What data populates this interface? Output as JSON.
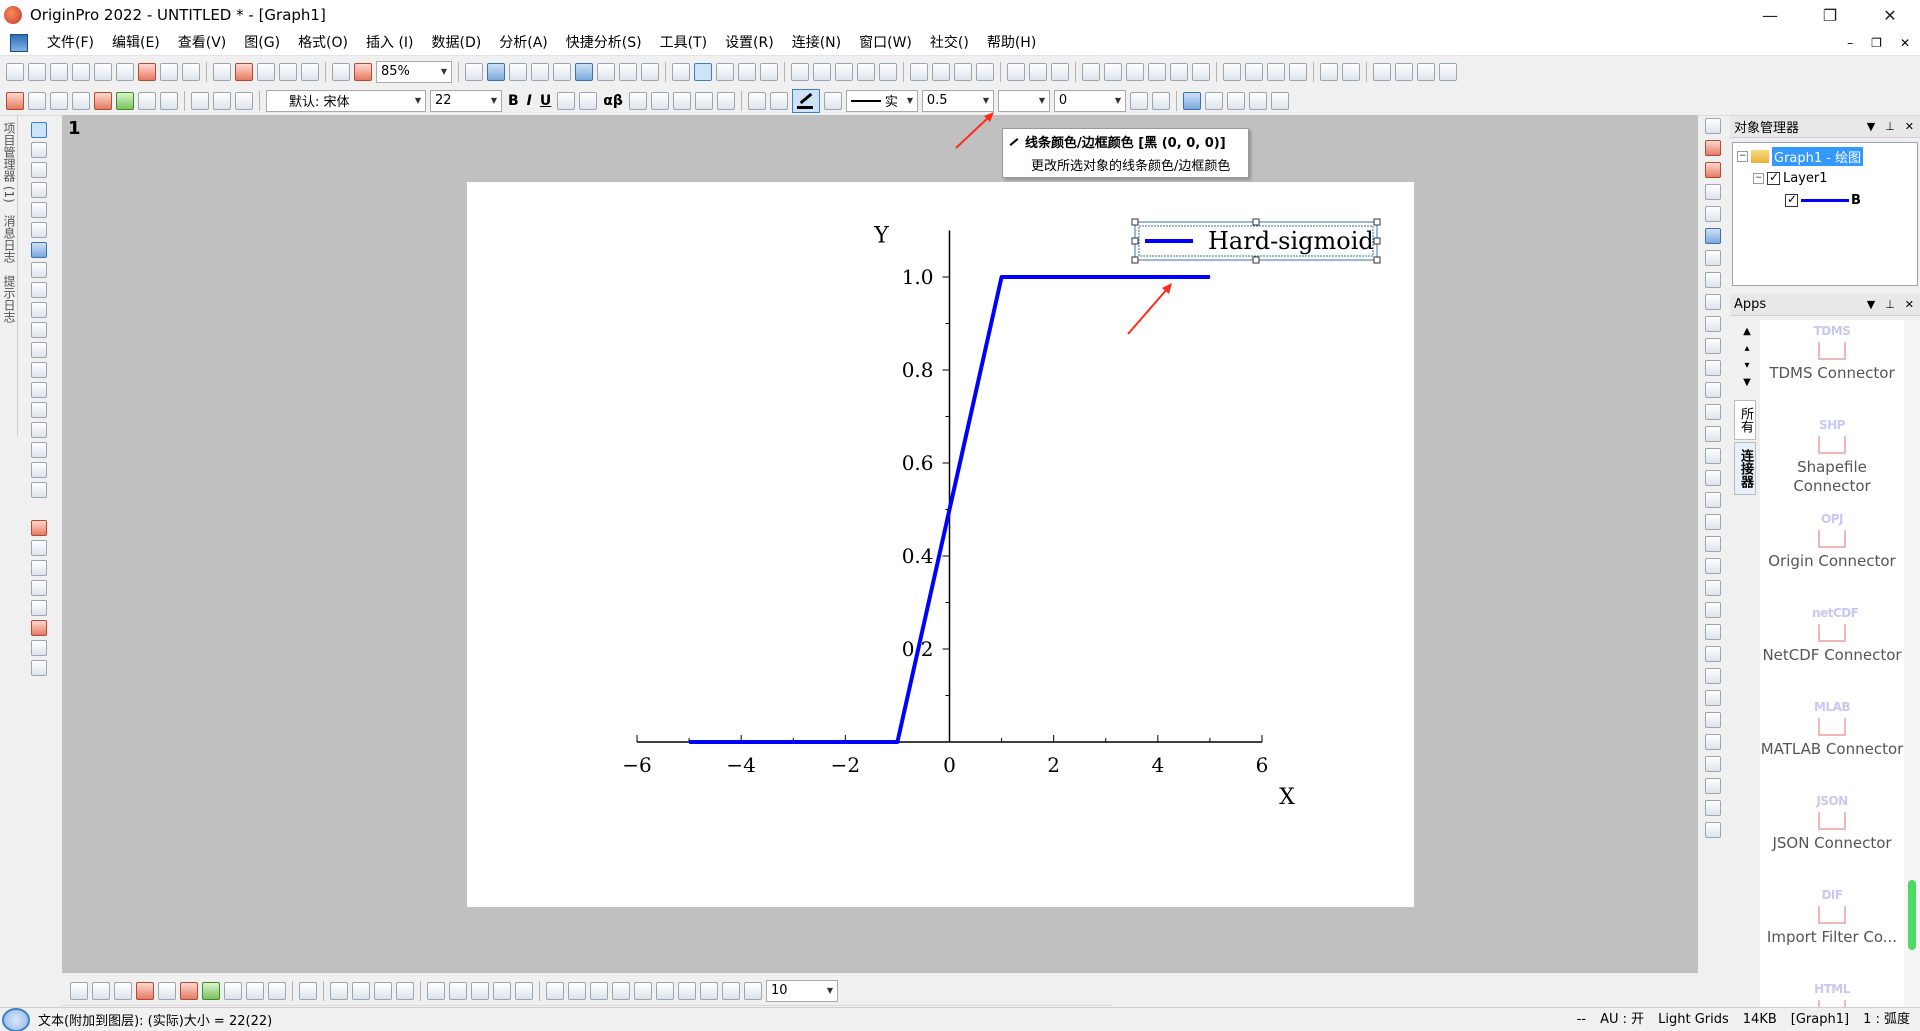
{
  "window": {
    "title": "OriginPro 2022 - UNTITLED * - [Graph1]",
    "controls": [
      "—",
      "❐",
      "✕"
    ],
    "mdi_controls": [
      "–",
      "❐",
      "✕"
    ]
  },
  "menu": [
    "文件(F)",
    "编辑(E)",
    "查看(V)",
    "图(G)",
    "格式(O)",
    "插入 (I)",
    "数据(D)",
    "分析(A)",
    "快捷分析(S)",
    "工具(T)",
    "设置(R)",
    "连接(N)",
    "窗口(W)",
    "社交()",
    "帮助(H)"
  ],
  "toolbar1": {
    "zoom_value": "85%"
  },
  "toolbar2": {
    "font_name": "默认: 宋体",
    "font_size": "22",
    "bold": "B",
    "italic": "I",
    "underline": "U",
    "greek": "αβ",
    "line_style": "实",
    "line_width": "0.5",
    "offset": "0"
  },
  "left_dock_tabs": [
    "项目管理器 (1)",
    "消息日志",
    "提示日志"
  ],
  "workspace": {
    "page_label": "1"
  },
  "tooltip": {
    "title": "线条颜色/边框颜色 [黑 (0, 0, 0)]",
    "description": "更改所选对象的线条颜色/边框颜色"
  },
  "chart_data": {
    "type": "line",
    "title": "",
    "xlabel": "X",
    "ylabel": "Y",
    "xlim": [
      -6,
      6
    ],
    "ylim": [
      0,
      1.1
    ],
    "x_ticks": [
      -6,
      -4,
      -2,
      0,
      2,
      4,
      6
    ],
    "x_tick_labels": [
      "−6",
      "−4",
      "−2",
      "0",
      "2",
      "4",
      "6"
    ],
    "y_ticks": [
      0.2,
      0.4,
      0.6,
      0.8,
      1.0
    ],
    "y_tick_labels": [
      "0.2",
      "0.4",
      "0.6",
      "0.8",
      "1.0"
    ],
    "series": [
      {
        "name": "Hard-sigmoid",
        "color": "#0000ff",
        "x": [
          -5,
          -1,
          1,
          5
        ],
        "y": [
          0,
          0,
          1,
          1
        ]
      }
    ],
    "legend": {
      "entries": [
        "Hard-sigmoid"
      ],
      "position": "top-right",
      "selected": true
    },
    "grid": false
  },
  "object_manager": {
    "title": "对象管理器",
    "graph_node": "Graph1 - 绘图",
    "layer_node": "Layer1",
    "series_node": "B"
  },
  "apps": {
    "title": "Apps",
    "tabs": [
      "所有",
      "连接器"
    ],
    "items": [
      {
        "logo": "TDMS",
        "name": "TDMS Connector"
      },
      {
        "logo": "SHP",
        "name": "Shapefile Connector"
      },
      {
        "logo": "OPJ",
        "name": "Origin Connector"
      },
      {
        "logo": "netCDF",
        "name": "NetCDF Connector"
      },
      {
        "logo": "MLAB",
        "name": "MATLAB Connector"
      },
      {
        "logo": "JSON",
        "name": "JSON Connector"
      },
      {
        "logo": "DIF",
        "name": "Import Filter Co..."
      },
      {
        "logo": "HTML",
        "name": ""
      }
    ]
  },
  "bottom_toolbar": {
    "size_value": "10"
  },
  "statusbar": {
    "left_text": "文本(附加到图层): (实际)大小 = 22(22)",
    "dashes": "--",
    "au": "AU : 开",
    "grids": "Light Grids",
    "mem": "14KB",
    "page": "[Graph1]",
    "angle": "1 : 弧度"
  }
}
